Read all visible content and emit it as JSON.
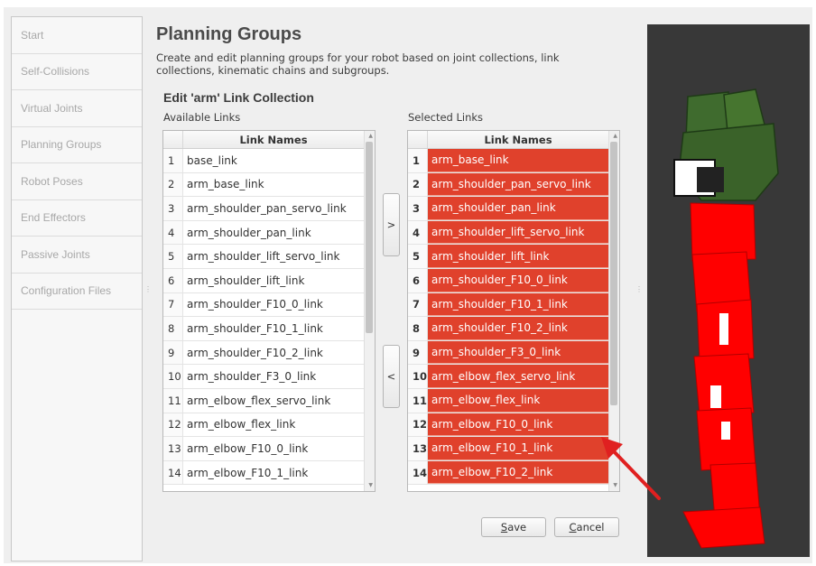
{
  "sidebar": {
    "items": [
      {
        "label": "Start"
      },
      {
        "label": "Self-Collisions"
      },
      {
        "label": "Virtual Joints"
      },
      {
        "label": "Planning Groups"
      },
      {
        "label": "Robot Poses"
      },
      {
        "label": "End Effectors"
      },
      {
        "label": "Passive Joints"
      },
      {
        "label": "Configuration Files"
      }
    ]
  },
  "main": {
    "title": "Planning Groups",
    "description_line1": "Create and edit planning groups for your robot based on joint collections, link",
    "description_line2": "collections, kinematic chains and subgroups.",
    "subtitle": "Edit 'arm' Link Collection",
    "available_caption": "Available Links",
    "selected_caption": "Selected Links",
    "column_header": "Link Names",
    "add_button": ">",
    "remove_button": "<",
    "save_mnemonic": "S",
    "save_rest": "ave",
    "cancel_mnemonic": "C",
    "cancel_rest": "ancel"
  },
  "available": {
    "rows": [
      {
        "num": "1",
        "name": "base_link"
      },
      {
        "num": "2",
        "name": "arm_base_link"
      },
      {
        "num": "3",
        "name": "arm_shoulder_pan_servo_link"
      },
      {
        "num": "4",
        "name": "arm_shoulder_pan_link"
      },
      {
        "num": "5",
        "name": "arm_shoulder_lift_servo_link"
      },
      {
        "num": "6",
        "name": "arm_shoulder_lift_link"
      },
      {
        "num": "7",
        "name": "arm_shoulder_F10_0_link"
      },
      {
        "num": "8",
        "name": "arm_shoulder_F10_1_link"
      },
      {
        "num": "9",
        "name": "arm_shoulder_F10_2_link"
      },
      {
        "num": "10",
        "name": "arm_shoulder_F3_0_link"
      },
      {
        "num": "11",
        "name": "arm_elbow_flex_servo_link"
      },
      {
        "num": "12",
        "name": "arm_elbow_flex_link"
      },
      {
        "num": "13",
        "name": "arm_elbow_F10_0_link"
      },
      {
        "num": "14",
        "name": "arm_elbow_F10_1_link"
      }
    ]
  },
  "selected": {
    "rows": [
      {
        "num": "1",
        "name": "arm_base_link"
      },
      {
        "num": "2",
        "name": "arm_shoulder_pan_servo_link"
      },
      {
        "num": "3",
        "name": "arm_shoulder_pan_link"
      },
      {
        "num": "4",
        "name": "arm_shoulder_lift_servo_link"
      },
      {
        "num": "5",
        "name": "arm_shoulder_lift_link"
      },
      {
        "num": "6",
        "name": "arm_shoulder_F10_0_link"
      },
      {
        "num": "7",
        "name": "arm_shoulder_F10_1_link"
      },
      {
        "num": "8",
        "name": "arm_shoulder_F10_2_link"
      },
      {
        "num": "9",
        "name": "arm_shoulder_F3_0_link"
      },
      {
        "num": "10",
        "name": "arm_elbow_flex_servo_link"
      },
      {
        "num": "11",
        "name": "arm_elbow_flex_link"
      },
      {
        "num": "12",
        "name": "arm_elbow_F10_0_link"
      },
      {
        "num": "13",
        "name": "arm_elbow_F10_1_link"
      },
      {
        "num": "14",
        "name": "arm_elbow_F10_2_link"
      }
    ]
  },
  "colors": {
    "selection": "#e0412c",
    "viewer_background": "#383838",
    "robot_highlight": "#ff0000",
    "gripper": "#3f6b2e",
    "arrow": "#e02020"
  },
  "icons": {
    "splitter_left": "splitter-handle-icon",
    "splitter_right": "splitter-handle-icon",
    "annotation": "red-arrow-icon"
  }
}
